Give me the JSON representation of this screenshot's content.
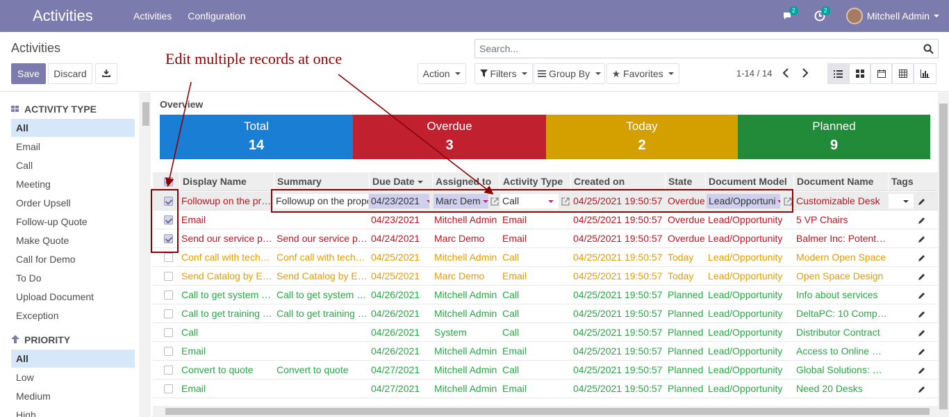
{
  "topbar": {
    "app_title": "Activities",
    "menu": [
      "Activities",
      "Configuration"
    ],
    "chat_badge": "2",
    "activity_badge": "2",
    "user_name": "Mitchell Admin"
  },
  "control": {
    "breadcrumb": "Activities",
    "save_label": "Save",
    "discard_label": "Discard",
    "search_placeholder": "Search...",
    "action_label": "Action",
    "filters_label": "Filters",
    "groupby_label": "Group By",
    "favorites_label": "Favorites",
    "pager": "1-14 / 14"
  },
  "sidebar": {
    "activity_type_title": "ACTIVITY TYPE",
    "activity_types": [
      "All",
      "Email",
      "Call",
      "Meeting",
      "Order Upsell",
      "Follow-up Quote",
      "Make Quote",
      "Call for Demo",
      "To Do",
      "Upload Document",
      "Exception"
    ],
    "priority_title": "PRIORITY",
    "priorities": [
      "All",
      "Low",
      "Medium",
      "High"
    ]
  },
  "overview": {
    "title": "Overview",
    "stats": [
      {
        "label": "Total",
        "value": "14",
        "color": "#1a7fd4"
      },
      {
        "label": "Overdue",
        "value": "3",
        "color": "#c1202f"
      },
      {
        "label": "Today",
        "value": "2",
        "color": "#d4a000"
      },
      {
        "label": "Planned",
        "value": "9",
        "color": "#228b3a"
      }
    ]
  },
  "table": {
    "columns": [
      "Display Name",
      "Summary",
      "Due Date",
      "Assigned to",
      "Activity Type",
      "Created on",
      "State",
      "Document Model",
      "Document Name",
      "Tags"
    ],
    "edit_row": {
      "display_name": "Followup on the propo",
      "summary": "Followup on the propo",
      "due_date": "04/23/2021",
      "assigned_to": "Marc Dem",
      "activity_type": "Call",
      "created_on": "04/25/2021 19:50:57",
      "state": "Overdue",
      "document_model": "Lead/Opportuni",
      "document_name": "Customizable Desk"
    },
    "rows": [
      {
        "display_name": "Email",
        "summary": "",
        "due_date": "04/23/2021",
        "assigned_to": "Mitchell Admin",
        "activity_type": "Email",
        "created_on": "04/25/2021 19:50:57",
        "state": "Overdue",
        "document_model": "Lead/Opportunity",
        "document_name": "5 VP Chairs",
        "color": "red",
        "checked": true
      },
      {
        "display_name": "Send our service pri…",
        "summary": "Send our service pri…",
        "due_date": "04/24/2021",
        "assigned_to": "Marc Demo",
        "activity_type": "Email",
        "created_on": "04/25/2021 19:50:57",
        "state": "Overdue",
        "document_model": "Lead/Opportunity",
        "document_name": "Balmer Inc: Potenti…",
        "color": "red",
        "checked": true
      },
      {
        "display_name": "Conf call with techni…",
        "summary": "Conf call with techni…",
        "due_date": "04/25/2021",
        "assigned_to": "Mitchell Admin",
        "activity_type": "Call",
        "created_on": "04/25/2021 19:50:57",
        "state": "Today",
        "document_model": "Lead/Opportunity",
        "document_name": "Modern Open Space",
        "color": "orange",
        "checked": false
      },
      {
        "display_name": "Send Catalog by E…",
        "summary": "Send Catalog by E…",
        "due_date": "04/25/2021",
        "assigned_to": "Marc Demo",
        "activity_type": "Email",
        "created_on": "04/25/2021 19:50:57",
        "state": "Today",
        "document_model": "Lead/Opportunity",
        "document_name": "Open Space Design",
        "color": "orange",
        "checked": false
      },
      {
        "display_name": "Call to get system r…",
        "summary": "Call to get system r…",
        "due_date": "04/26/2021",
        "assigned_to": "Mitchell Admin",
        "activity_type": "Call",
        "created_on": "04/25/2021 19:50:57",
        "state": "Planned",
        "document_model": "Lead/Opportunity",
        "document_name": "Info about services",
        "color": "green",
        "checked": false
      },
      {
        "display_name": "Call to get training n…",
        "summary": "Call to get training n…",
        "due_date": "04/26/2021",
        "assigned_to": "Mitchell Admin",
        "activity_type": "Call",
        "created_on": "04/25/2021 19:50:57",
        "state": "Planned",
        "document_model": "Lead/Opportunity",
        "document_name": "DeltaPC: 10 Compu…",
        "color": "green",
        "checked": false
      },
      {
        "display_name": "Call",
        "summary": "",
        "due_date": "04/26/2021",
        "assigned_to": "System",
        "activity_type": "Call",
        "created_on": "04/25/2021 19:50:57",
        "state": "Planned",
        "document_model": "Lead/Opportunity",
        "document_name": "Distributor Contract",
        "color": "green",
        "checked": false
      },
      {
        "display_name": "Email",
        "summary": "",
        "due_date": "04/26/2021",
        "assigned_to": "Mitchell Admin",
        "activity_type": "Email",
        "created_on": "04/25/2021 19:50:57",
        "state": "Planned",
        "document_model": "Lead/Opportunity",
        "document_name": "Access to Online C…",
        "color": "green",
        "checked": false
      },
      {
        "display_name": "Convert to quote",
        "summary": "Convert to quote",
        "due_date": "04/27/2021",
        "assigned_to": "Mitchell Admin",
        "activity_type": "Call",
        "created_on": "04/25/2021 19:50:57",
        "state": "Planned",
        "document_model": "Lead/Opportunity",
        "document_name": "Global Solutions: F…",
        "color": "green",
        "checked": false
      },
      {
        "display_name": "Email",
        "summary": "",
        "due_date": "04/27/2021",
        "assigned_to": "Mitchell Admin",
        "activity_type": "Email",
        "created_on": "04/25/2021 19:50:57",
        "state": "Planned",
        "document_model": "Lead/Opportunity",
        "document_name": "Need 20 Desks",
        "color": "green",
        "checked": false
      }
    ]
  },
  "annotation": {
    "text": "Edit multiple records at once"
  }
}
